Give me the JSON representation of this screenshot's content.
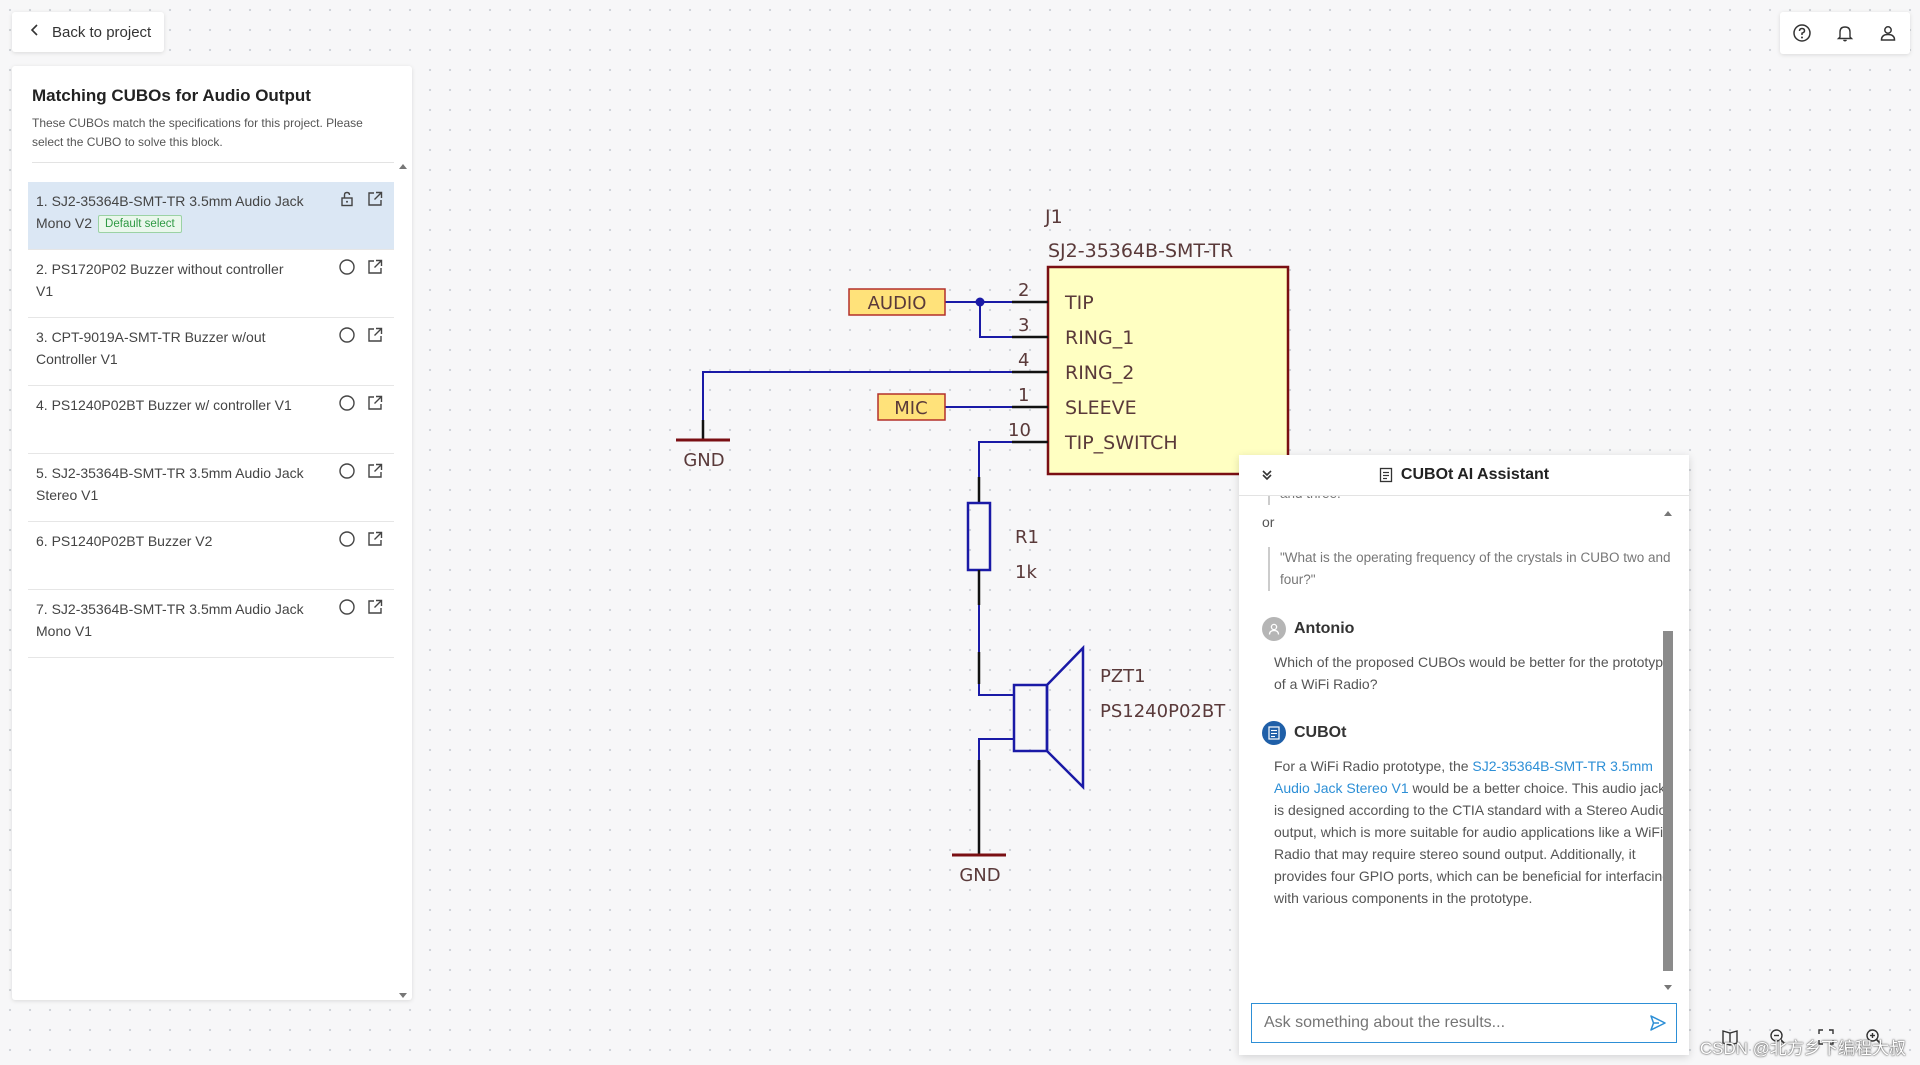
{
  "header": {
    "back_label": "Back to project"
  },
  "left_panel": {
    "title": "Matching CUBOs for Audio Output",
    "description": "These CUBOs match the specifications for this project. Please select the CUBO to solve this block.",
    "items": [
      {
        "label": "1. SJ2-35364B-SMT-TR 3.5mm Audio Jack Mono V2",
        "badge": "Default select",
        "selected": true
      },
      {
        "label": "2. PS1720P02 Buzzer without controller V1"
      },
      {
        "label": "3. CPT-9019A-SMT-TR Buzzer w/out Controller V1"
      },
      {
        "label": "4. PS1240P02BT Buzzer w/ controller V1"
      },
      {
        "label": "5. SJ2-35364B-SMT-TR 3.5mm Audio Jack Stereo V1"
      },
      {
        "label": "6. PS1240P02BT Buzzer V2"
      },
      {
        "label": "7. SJ2-35364B-SMT-TR 3.5mm Audio Jack Mono V1"
      }
    ]
  },
  "schematic": {
    "ref": "J1",
    "part": "SJ2-35364B-SMT-TR",
    "pins": [
      {
        "num": "2",
        "name": "TIP"
      },
      {
        "num": "3",
        "name": "RING_1"
      },
      {
        "num": "4",
        "name": "RING_2"
      },
      {
        "num": "1",
        "name": "SLEEVE"
      },
      {
        "num": "10",
        "name": "TIP_SWITCH"
      }
    ],
    "net_audio": "AUDIO",
    "net_mic": "MIC",
    "gnd_label": "GND",
    "resistor_ref": "R1",
    "resistor_val": "1k",
    "buzzer_ref": "PZT1",
    "buzzer_part": "PS1240P02BT"
  },
  "assistant": {
    "title": "CUBOt AI Assistant",
    "partial_line": "and three.",
    "or_text": "or",
    "quote": "\"What is the operating frequency of the crystals in CUBO two and four?\"",
    "user_name": "Antonio",
    "user_message": "Which of the proposed CUBOs would be better for the prototype of a WiFi Radio?",
    "bot_name": "CUBOt",
    "bot_pre": "For a WiFi Radio prototype, the ",
    "bot_link": "SJ2-35364B-SMT-TR 3.5mm Audio Jack Stereo V1",
    "bot_post": " would be a better choice. This audio jack is designed according to the CTIA standard with a Stereo Audio output, which is more suitable for audio applications like a WiFi Radio that may require stereo sound output. Additionally, it provides four GPIO ports, which can be beneficial for interfacing with various components in the prototype.",
    "input_placeholder": "Ask something about the results..."
  },
  "watermark": "CSDN @北方乡下编程大叔",
  "colors": {
    "wire": "#1a1aa6",
    "component": "#7a0f13",
    "body_fill": "#ffffc2",
    "pin_text": "#5a3a3a",
    "net_label_fill": "#ffe27a",
    "net_label_border": "#b3302a",
    "link": "#2d8fd6",
    "selected_row": "#dbe7f4"
  }
}
